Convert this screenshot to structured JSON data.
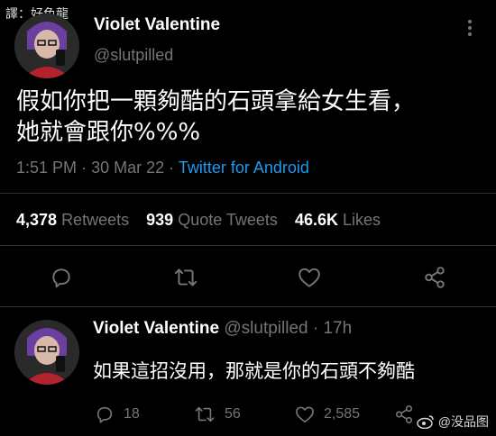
{
  "watermark_top": "譯：好色龍",
  "watermark_bottom": "@没品图",
  "tweet": {
    "display_name": "Violet Valentine",
    "handle": "@slutpilled",
    "text_line1": "假如你把一顆夠酷的石頭拿給女生看，",
    "text_line2": "她就會跟你%%%",
    "time": "1:51 PM",
    "dot": "·",
    "date": "30 Mar 22",
    "source": "Twitter for Android",
    "retweets_count": "4,378",
    "retweets_label": "Retweets",
    "quotes_count": "939",
    "quotes_label": "Quote Tweets",
    "likes_count": "46.6K",
    "likes_label": "Likes"
  },
  "reply": {
    "display_name": "Violet Valentine",
    "handle": "@slutpilled",
    "dot": "·",
    "age": "17h",
    "text": "如果這招沒用，那就是你的石頭不夠酷",
    "replies": "18",
    "retweets": "56",
    "likes": "2,585"
  },
  "colors": {
    "background": "#000000",
    "text": "#e7e9ea",
    "muted": "#71767b",
    "link": "#1d9bf0",
    "divider": "#2f3336"
  },
  "icons": [
    "more-icon",
    "reply-icon",
    "retweet-icon",
    "like-icon",
    "share-icon",
    "weibo-icon"
  ]
}
